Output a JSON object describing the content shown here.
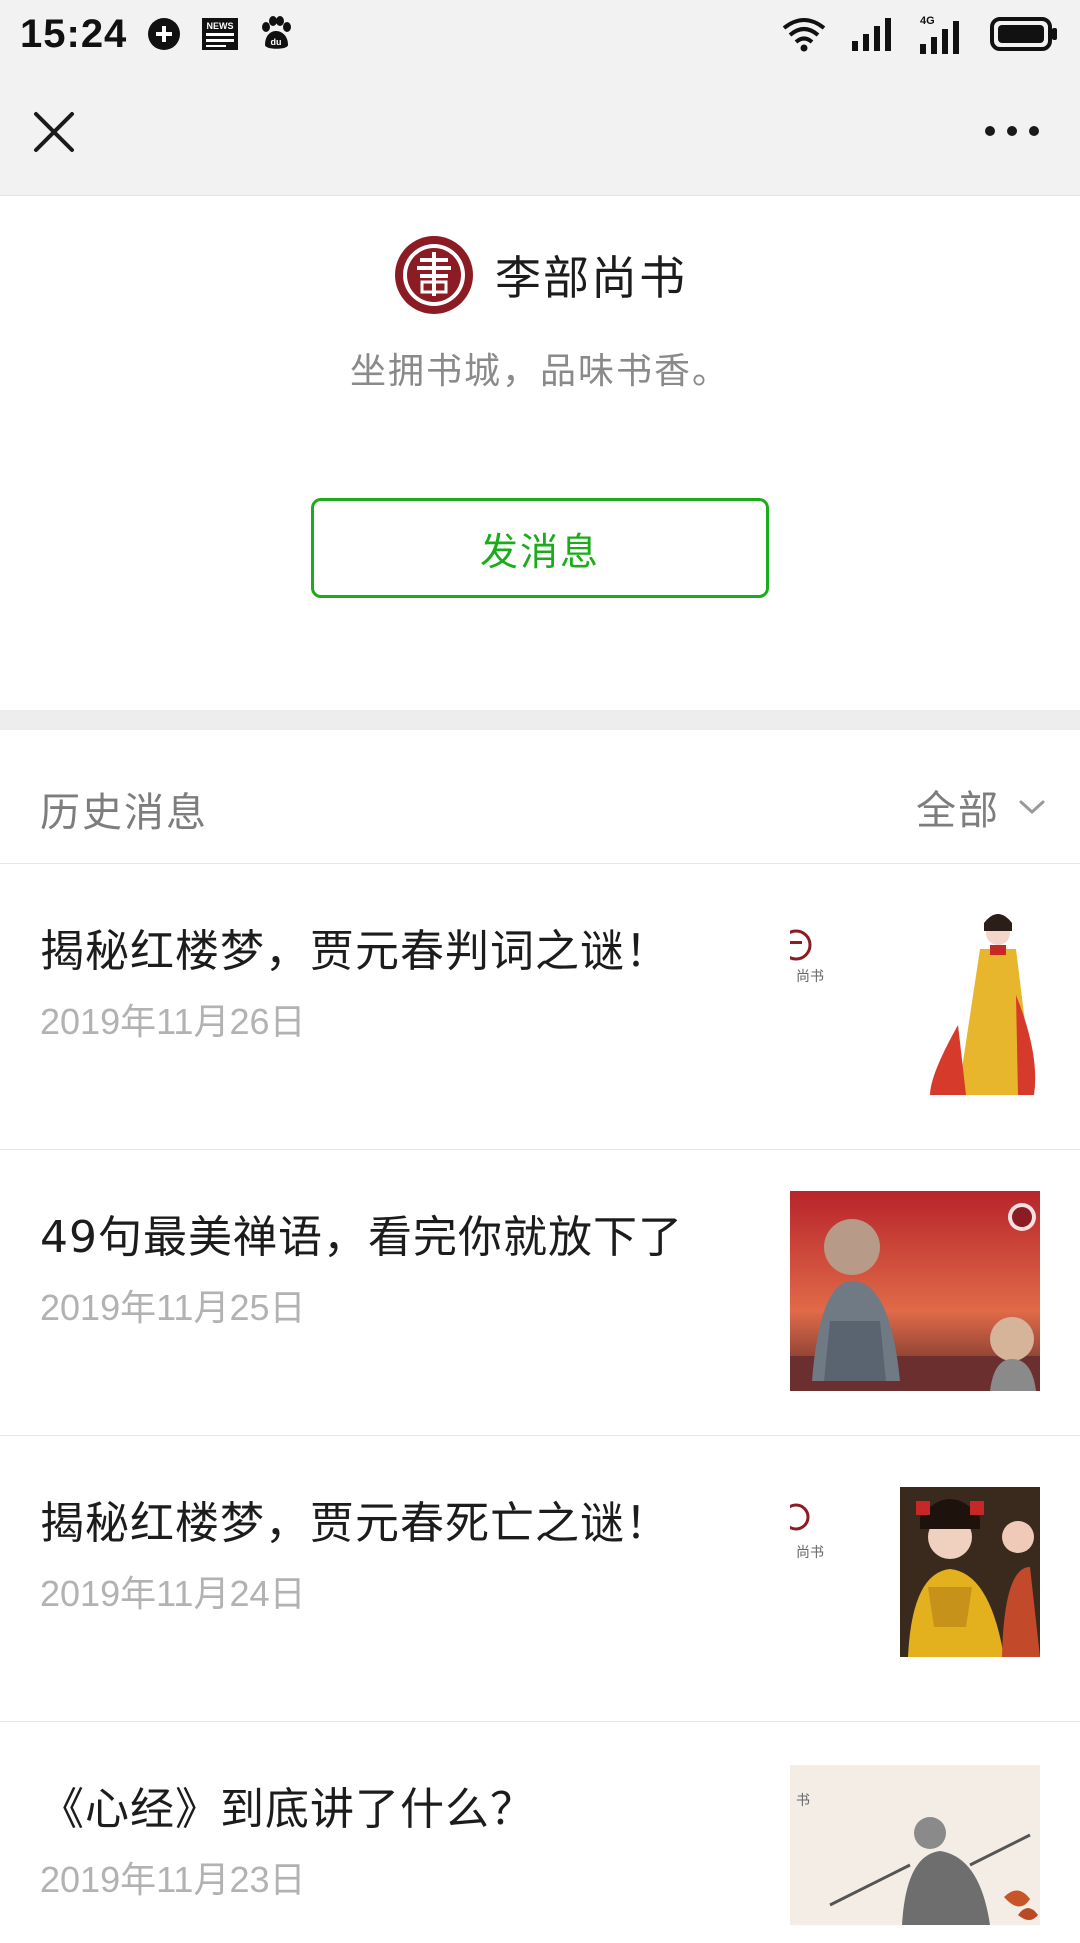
{
  "status_bar": {
    "time": "15:24",
    "left_icons": [
      "sync-icon",
      "news-app-icon",
      "baidu-paw-icon"
    ],
    "right_icons": [
      "wifi-icon",
      "signal-icon",
      "signal-4g-icon",
      "battery-icon"
    ],
    "network_label": "4G",
    "news_label": "NEWS",
    "baidu_label": "du"
  },
  "nav": {
    "close_icon": "close-icon",
    "more_icon": "more-dots-icon"
  },
  "profile": {
    "account_name": "李部尚书",
    "description": "坐拥书城，品味书香。",
    "send_button_label": "发消息",
    "brand_color": "#8b1c24",
    "accent_color": "#1aad19"
  },
  "history": {
    "title": "历史消息",
    "filter_label": "全部",
    "articles": [
      {
        "title": "揭秘红楼梦，贾元春判词之谜！",
        "date": "2019年11月26日",
        "thumb_text": "尚书"
      },
      {
        "title": "49句最美禅语，看完你就放下了",
        "date": "2019年11月25日",
        "thumb_text": ""
      },
      {
        "title": "揭秘红楼梦，贾元春死亡之谜！",
        "date": "2019年11月24日",
        "thumb_text": "尚书"
      },
      {
        "title": "《心经》到底讲了什么？",
        "date": "2019年11月23日",
        "thumb_text": "书"
      }
    ]
  }
}
